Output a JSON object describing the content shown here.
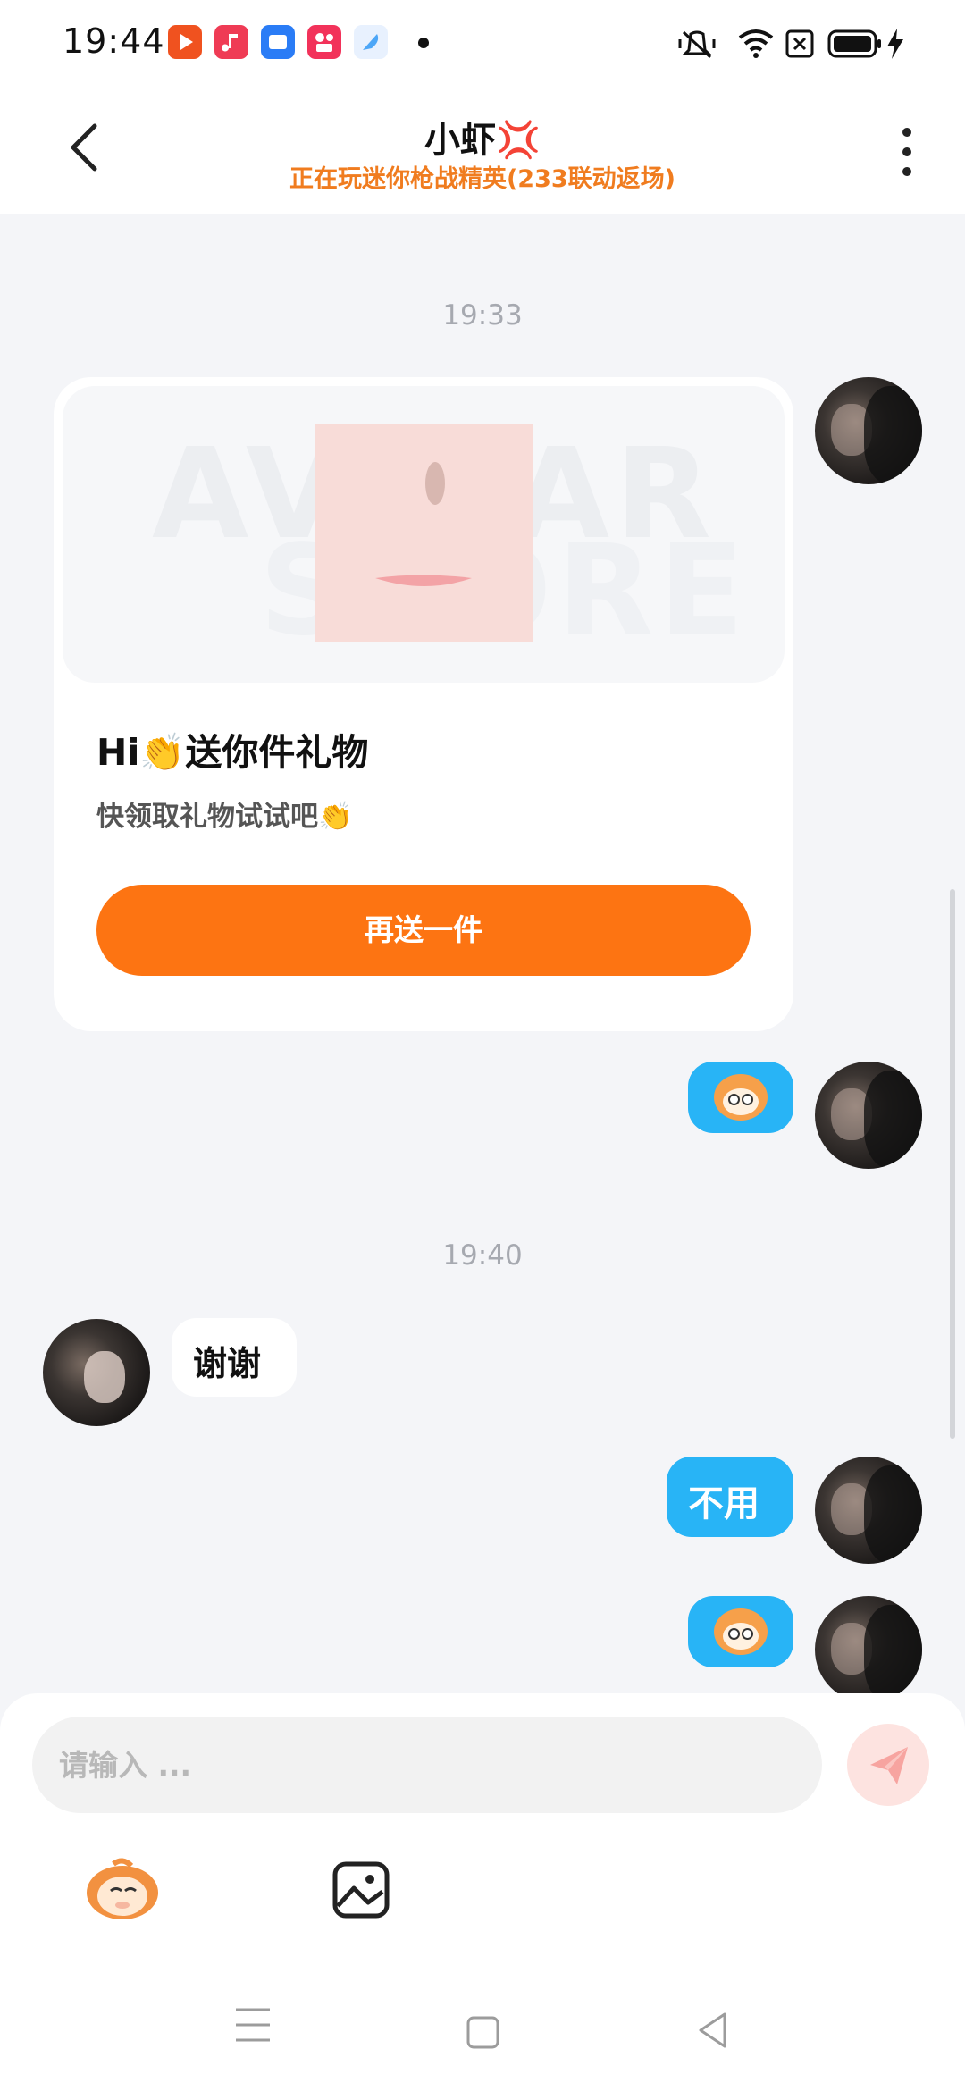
{
  "status_bar": {
    "time": "19:44",
    "apps": [
      {
        "icon": "video-app-icon",
        "color": "#f0521f"
      },
      {
        "icon": "music-app-icon",
        "color": "#ef3b55"
      },
      {
        "icon": "files-app-icon",
        "color": "#2a7cf6"
      },
      {
        "icon": "kuaishou-app-icon",
        "color": "#f2325a"
      },
      {
        "icon": "feather-app-icon",
        "color": "#4ca6f7"
      }
    ],
    "indicators": [
      "mute-icon",
      "wifi-icon",
      "sim-icon",
      "battery-icon",
      "charging-icon"
    ]
  },
  "header": {
    "title": "小虾💢",
    "subtitle": "正在玩迷你枪战精英(233联动返场)"
  },
  "messages": {
    "time1": "19:33",
    "gift": {
      "watermark_line1": "AVATAR",
      "watermark_line2": "STORE",
      "title": "Hi👏送你件礼物",
      "desc": "快领取礼物试试吧👏",
      "button": "再送一件"
    },
    "time2": "19:40",
    "received_text": "谢谢",
    "sent_text": "不用"
  },
  "input": {
    "placeholder": "请输入 ..."
  },
  "colors": {
    "accent_orange": "#fd7412",
    "bubble_blue": "#28b4f6",
    "subtitle_orange": "#f07c1f"
  }
}
